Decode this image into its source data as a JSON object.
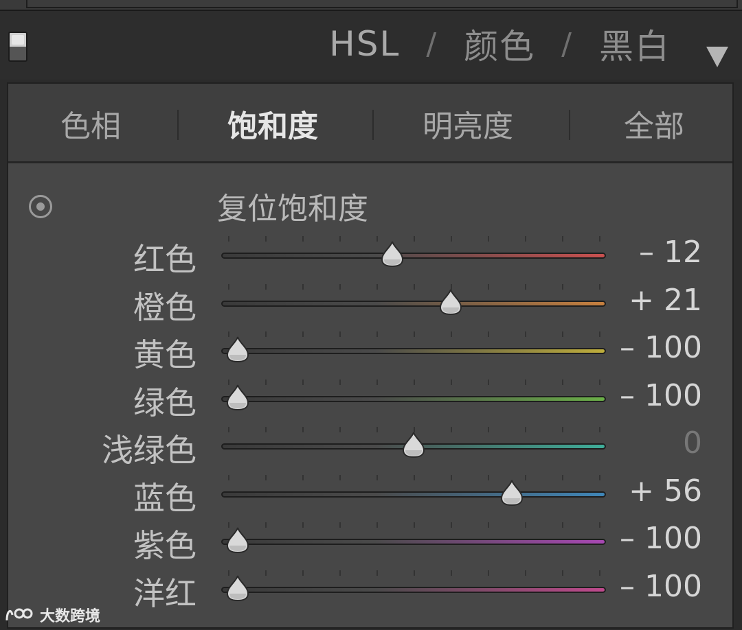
{
  "header": {
    "tabs": [
      {
        "label": "HSL",
        "active": true
      },
      {
        "label": "颜色",
        "active": false
      },
      {
        "label": "黑白",
        "active": false
      }
    ],
    "separator": "/"
  },
  "subtabs": [
    {
      "label": "色相",
      "active": false
    },
    {
      "label": "饱和度",
      "active": true
    },
    {
      "label": "明亮度",
      "active": false
    },
    {
      "label": "全部",
      "active": false
    }
  ],
  "reset": {
    "label": "复位饱和度"
  },
  "sliders": [
    {
      "label": "红色",
      "value_text": "– 12",
      "value": -12,
      "color": "#c9504f"
    },
    {
      "label": "橙色",
      "value_text": "+ 21",
      "value": 21,
      "color": "#c7803f"
    },
    {
      "label": "黄色",
      "value_text": "– 100",
      "value": -100,
      "color": "#bfae3c"
    },
    {
      "label": "绿色",
      "value_text": "– 100",
      "value": -100,
      "color": "#6bb048"
    },
    {
      "label": "浅绿色",
      "value_text": "0",
      "value": 0,
      "color": "#3fae9a"
    },
    {
      "label": "蓝色",
      "value_text": "+ 56",
      "value": 56,
      "color": "#3f86b8"
    },
    {
      "label": "紫色",
      "value_text": "– 100",
      "value": -100,
      "color": "#a848b4"
    },
    {
      "label": "洋红",
      "value_text": "– 100",
      "value": -100,
      "color": "#c04a8e"
    }
  ],
  "watermark": {
    "text": "大数跨境"
  }
}
